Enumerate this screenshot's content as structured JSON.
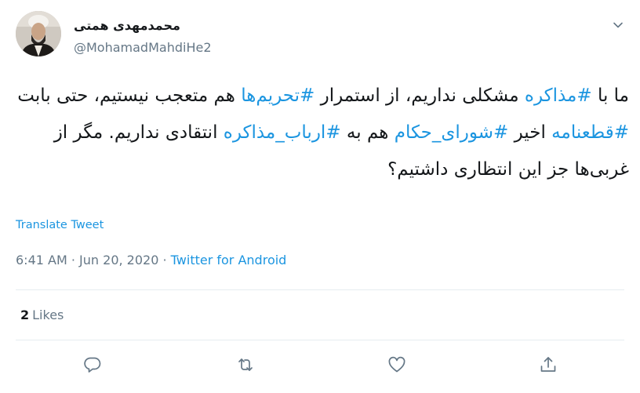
{
  "user": {
    "display_name": "محمدمهدی همتی",
    "handle": "@MohamadMahdiHe2"
  },
  "tweet": {
    "segments": [
      {
        "text": "ما با ",
        "hashtag": false
      },
      {
        "text": "#مذاکره",
        "hashtag": true
      },
      {
        "text": " مشکلی نداریم، از استمرار ",
        "hashtag": false
      },
      {
        "text": "#تحریم‌ها",
        "hashtag": true
      },
      {
        "text": " هم متعجب نیستیم، حتی بابت ",
        "hashtag": false
      },
      {
        "text": "#قطعنامه",
        "hashtag": true
      },
      {
        "text": " اخیر ",
        "hashtag": false
      },
      {
        "text": "#شورای_حکام",
        "hashtag": true
      },
      {
        "text": " هم به ",
        "hashtag": false
      },
      {
        "text": "#ارباب_مذاکره",
        "hashtag": true
      },
      {
        "text": " انتقادی نداریم. مگر از غربی‌ها جز این انتظاری داشتیم؟",
        "hashtag": false
      }
    ],
    "translate_label": "Translate Tweet",
    "time": "6:41 AM",
    "date": "Jun 20, 2020",
    "separator": "·",
    "source": "Twitter for Android",
    "likes_count": "2",
    "likes_label": "Likes"
  },
  "icons": {
    "caret": "chevron-down-icon",
    "reply": "reply-icon",
    "retweet": "retweet-icon",
    "like": "heart-icon",
    "share": "share-icon"
  },
  "colors": {
    "link": "#1b95e0",
    "text": "#14171a",
    "secondary": "#657786",
    "divider": "#e6ecf0"
  }
}
